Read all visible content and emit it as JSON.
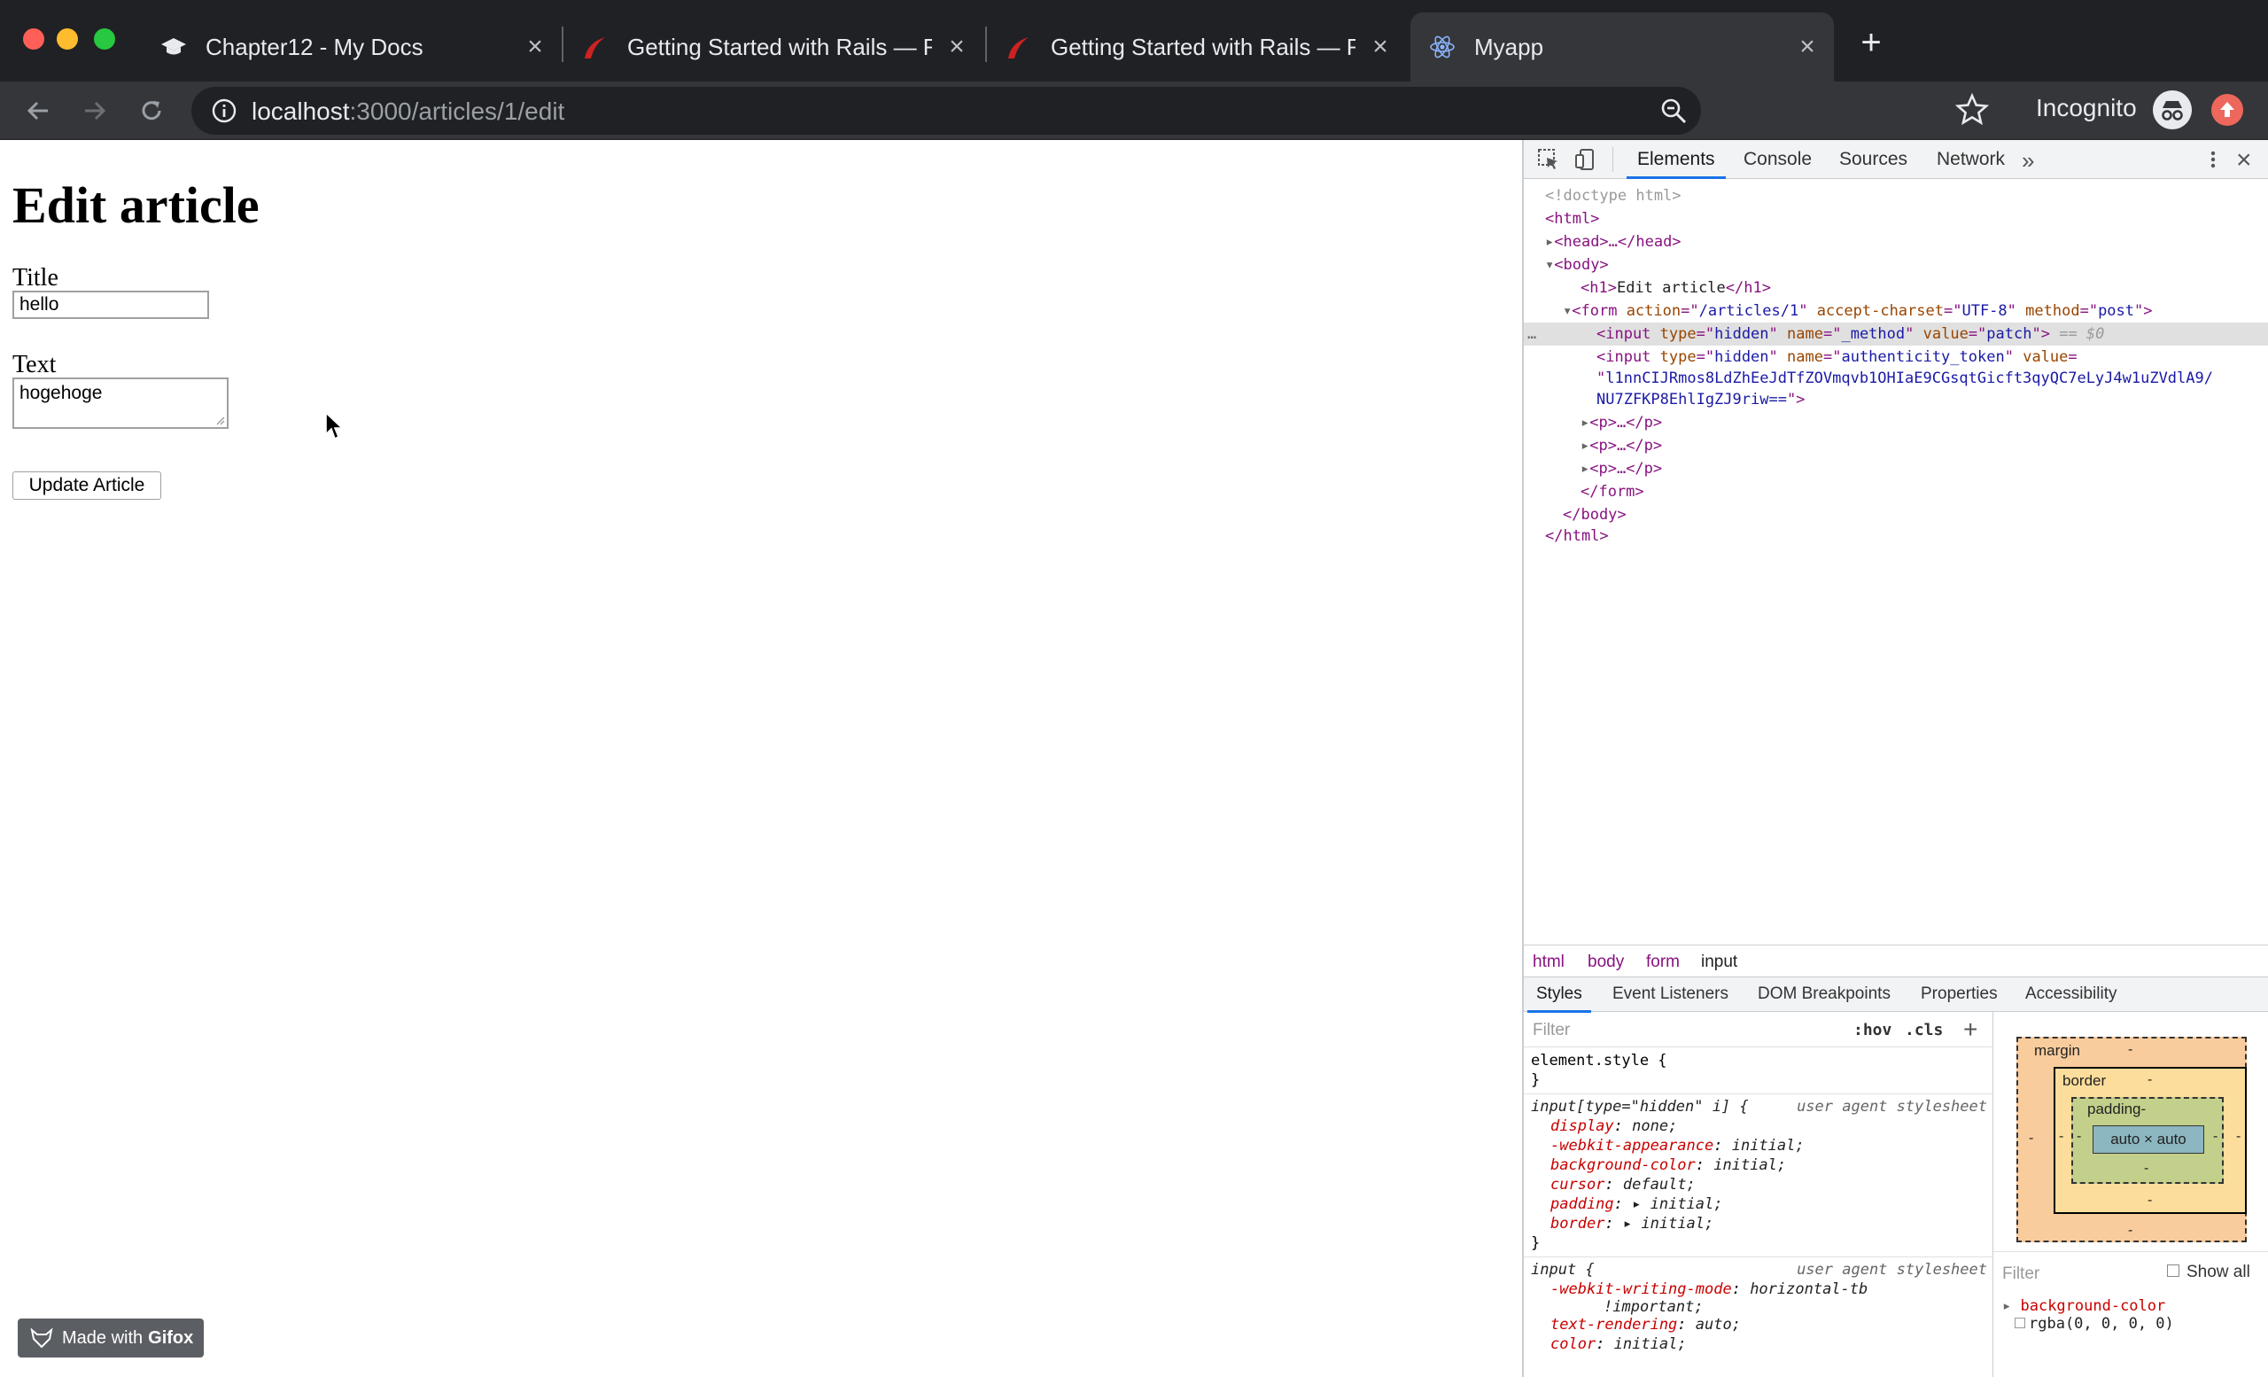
{
  "browser": {
    "tabs": [
      {
        "title": "Chapter12 - My Docs",
        "favicon": "graduation-cap-icon"
      },
      {
        "title": "Getting Started with Rails — Ru",
        "favicon": "rails-icon"
      },
      {
        "title": "Getting Started with Rails — Ru",
        "favicon": "rails-icon"
      },
      {
        "title": "Myapp",
        "favicon": "react-icon"
      }
    ],
    "new_tab": "+",
    "url_host": "localhost",
    "url_path": ":3000/articles/1/edit",
    "incognito_label": "Incognito"
  },
  "page": {
    "heading": "Edit article",
    "title_label": "Title",
    "title_value": "hello",
    "text_label": "Text",
    "text_value": "hogehoge",
    "submit_label": "Update Article"
  },
  "watermark": {
    "prefix": "Made with",
    "brand": "Gifox"
  },
  "devtools": {
    "tabs": [
      "Elements",
      "Console",
      "Sources",
      "Network"
    ],
    "more": "»",
    "dom": {
      "doctype": "<!doctype html>",
      "html_open": "<html>",
      "head": "<head>…</head>",
      "body_open": "<body>",
      "h1_text": "Edit article",
      "form_action": "/articles/1",
      "form_charset": "UTF-8",
      "form_method": "post",
      "input1_type": "hidden",
      "input1_name": "_method",
      "input1_value": "patch",
      "eq_marker": "== $0",
      "input2_type": "hidden",
      "input2_name": "authenticity_token",
      "token_line1": "l1nnCIJRmos8LdZhEeJdTfZOVmqvb1OHIaE9CGsqtGicft3qyQC7eLyJ4w1uZVdlA9/",
      "token_line2": "NU7ZFKP8EhlIgZJ9riw==",
      "p_collapsed": "<p>…</p>",
      "form_close": "</form>",
      "body_close": "</body>",
      "html_close": "</html>"
    },
    "breadcrumbs": [
      "html",
      "body",
      "form",
      "input"
    ],
    "subtabs": [
      "Styles",
      "Event Listeners",
      "DOM Breakpoints",
      "Properties",
      "Accessibility"
    ],
    "styles": {
      "filter_placeholder": "Filter",
      "hov": ":hov",
      "cls": ".cls",
      "element_style": "element.style {",
      "close_brace": "}",
      "rule1_selector": "input[type=\"hidden\" i] {",
      "rule1_source": "user agent stylesheet",
      "rule1_props": [
        {
          "name": "display",
          "value": "none;"
        },
        {
          "name": "-webkit-appearance",
          "value": "initial;"
        },
        {
          "name": "background-color",
          "value": "initial;"
        },
        {
          "name": "cursor",
          "value": "default;"
        },
        {
          "name": "padding",
          "value": "▸ initial;"
        },
        {
          "name": "border",
          "value": "▸ initial;"
        }
      ],
      "rule2_selector": "input {",
      "rule2_source": "user agent stylesheet",
      "rule2_props": [
        {
          "name": "-webkit-writing-mode",
          "value": "horizontal-tb"
        },
        {
          "name": "",
          "value": "!important;"
        },
        {
          "name": "text-rendering",
          "value": "auto;"
        },
        {
          "name": "color",
          "value": "initial;"
        }
      ]
    },
    "box_model": {
      "margin_label": "margin",
      "border_label": "border",
      "padding_label": "padding-",
      "content": "auto × auto",
      "dash": "-",
      "filter_placeholder": "Filter",
      "show_all": "Show all",
      "computed_prop": "background-color",
      "computed_value": "rgba(0, 0, 0, 0)"
    }
  },
  "colors": {
    "chrome_dark": "#202124",
    "chrome_tab": "#35363a",
    "devtools_accent": "#1a73e8",
    "tag": "#881280",
    "attr": "#994500",
    "value": "#1a1aa6"
  }
}
